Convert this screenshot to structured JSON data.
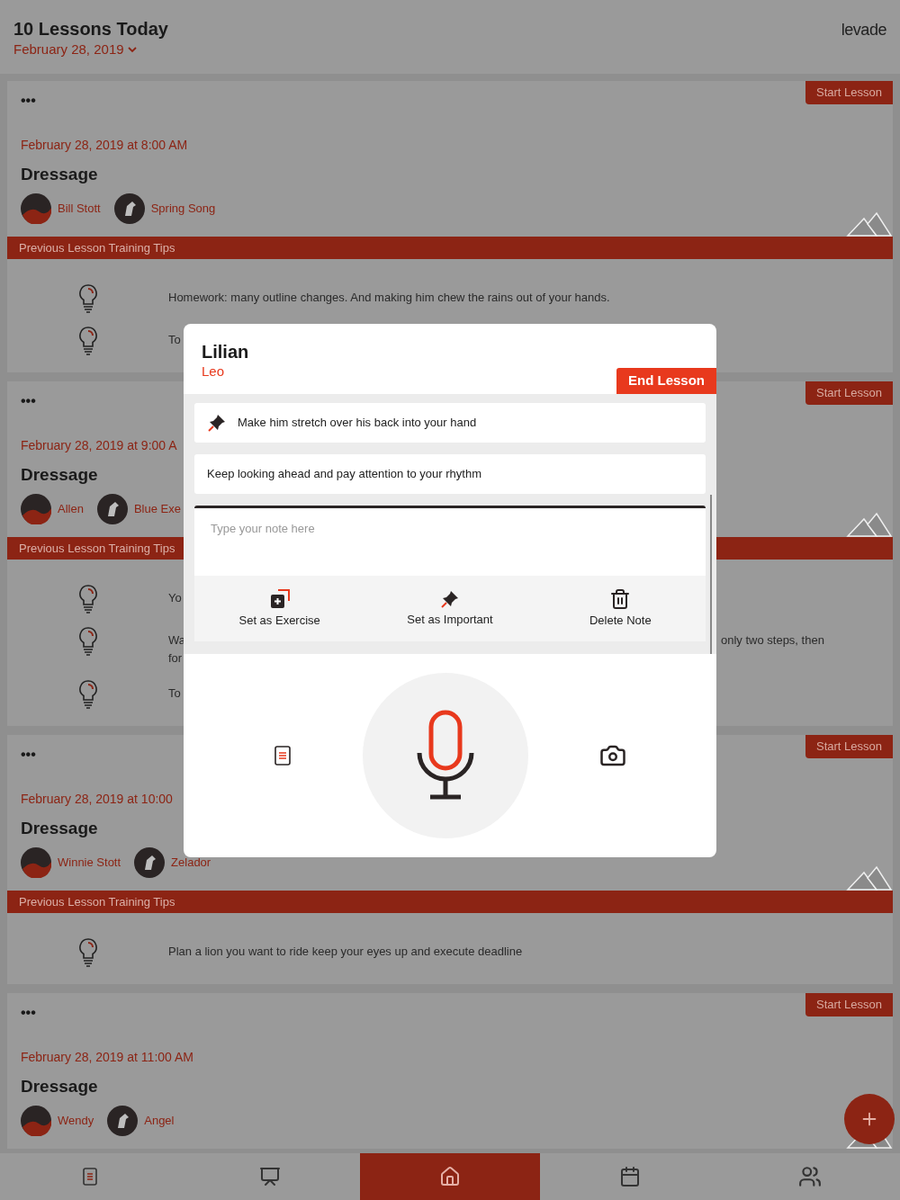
{
  "header": {
    "title": "10 Lessons Today",
    "date": "February 28, 2019",
    "logo": "levade"
  },
  "lessons": [
    {
      "action": "Start Lesson",
      "menu": "•••",
      "datetime": "February 28, 2019 at 8:00 AM",
      "discipline": "Dressage",
      "rider": "Bill Stott",
      "horse": "Spring Song",
      "tips_title": "Previous Lesson Training Tips",
      "tips": [
        {
          "text": "Homework: many outline changes. And making him chew the rains out of your hands."
        },
        {
          "text": "To"
        }
      ]
    },
    {
      "action": "Start Lesson",
      "menu": "•••",
      "datetime": "February 28, 2019 at 9:00 A",
      "discipline": "Dressage",
      "rider": "Allen",
      "horse": "Blue Exe",
      "tips_title": "Previous Lesson Training Tips",
      "tips": [
        {
          "text": "Yo"
        },
        {
          "text": "Wa",
          "text_line_2": "for",
          "text_right": "only two steps, then"
        },
        {
          "text": "To"
        }
      ]
    },
    {
      "action": "Start Lesson",
      "menu": "•••",
      "datetime": "February 28, 2019 at 10:00",
      "discipline": "Dressage",
      "rider": "Winnie Stott",
      "horse": "Zelador",
      "tips_title": "Previous Lesson Training Tips",
      "tips": [
        {
          "text": "Plan a lion you want to ride keep your eyes up and execute deadline"
        }
      ]
    },
    {
      "action": "Start Lesson",
      "menu": "•••",
      "datetime": "February 28, 2019 at 11:00 AM",
      "discipline": "Dressage",
      "rider": "Wendy",
      "horse": "Angel"
    }
  ],
  "modal": {
    "rider": "Lilian",
    "horse": "Leo",
    "end_button": "End Lesson",
    "notes": [
      {
        "text": "Make him stretch over his back into your hand",
        "pinned": true
      },
      {
        "text": "Keep looking ahead and pay attention to your rhythm",
        "pinned": false
      }
    ],
    "note_input": {
      "placeholder": "Type your note here"
    },
    "actions": [
      {
        "kind": "exercise",
        "label": "Set as Exercise"
      },
      {
        "kind": "important",
        "label": "Set as Important"
      },
      {
        "kind": "delete",
        "label": "Delete Note"
      }
    ]
  },
  "nav": [
    {
      "kind": "notes",
      "selected": false
    },
    {
      "kind": "board",
      "selected": false
    },
    {
      "kind": "home",
      "selected": true
    },
    {
      "kind": "calendar",
      "selected": false
    },
    {
      "kind": "people",
      "selected": false
    }
  ]
}
